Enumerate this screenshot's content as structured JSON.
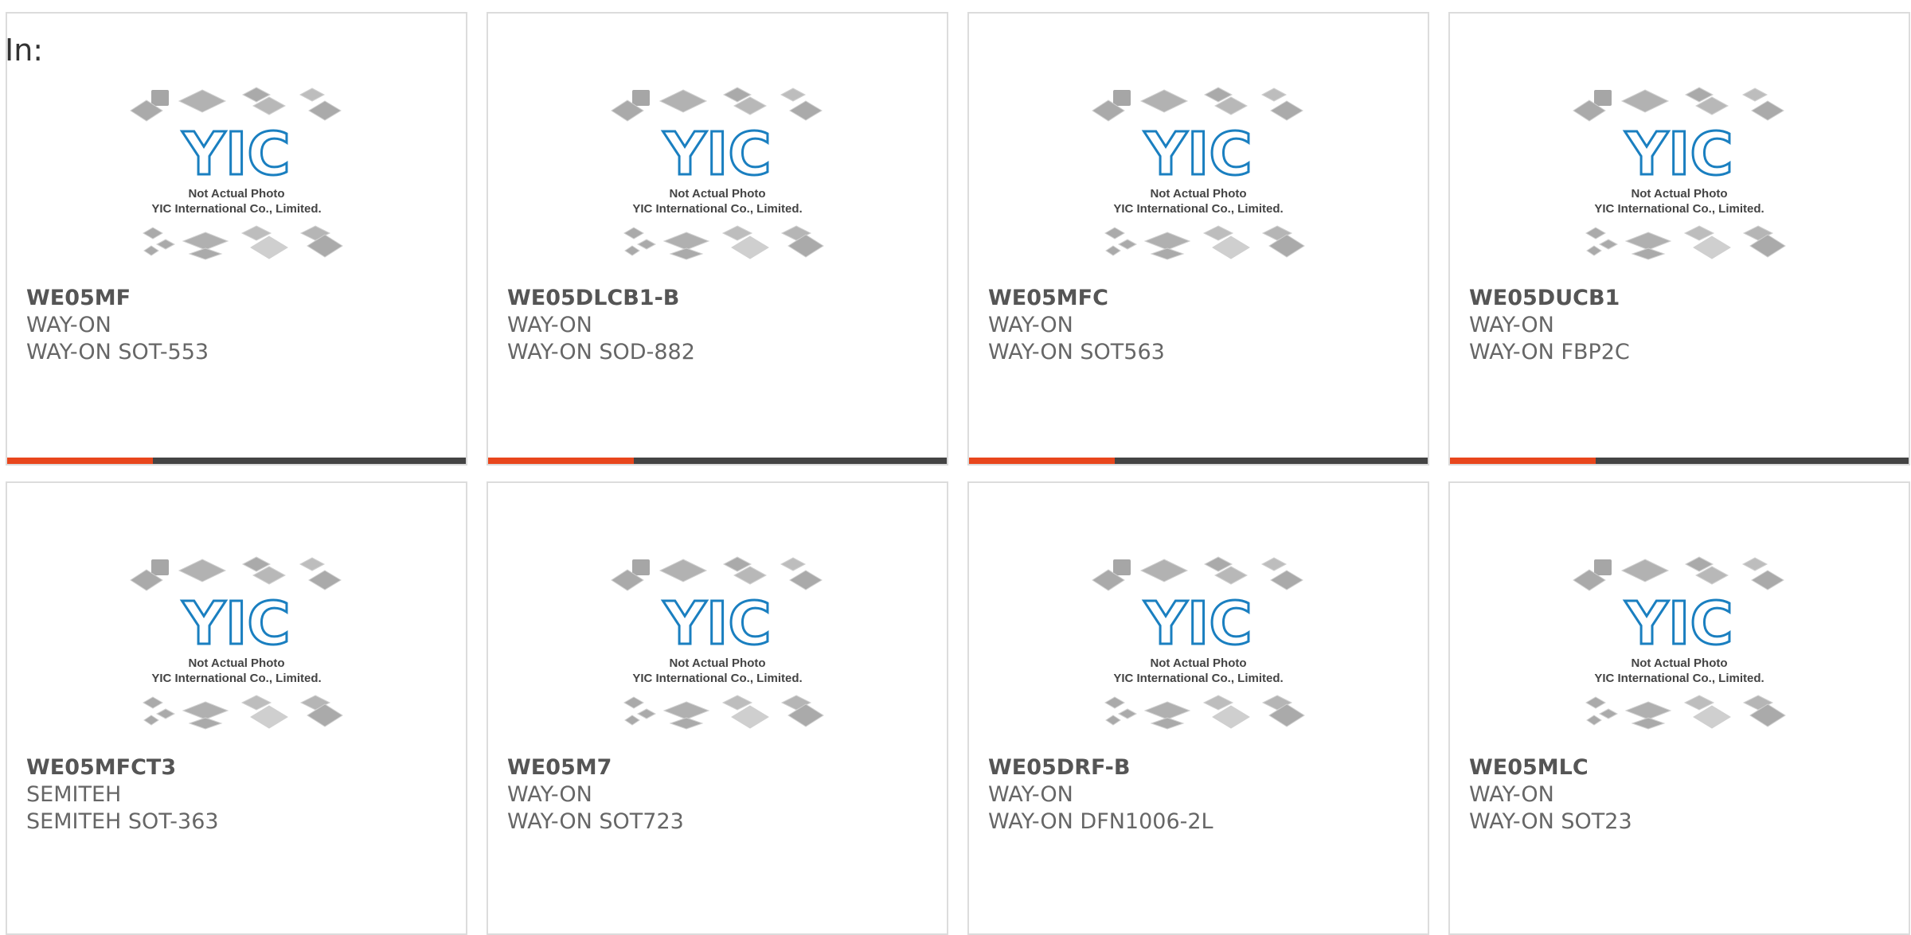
{
  "filter_label": "In:",
  "placeholder": {
    "caption_line1": "Not Actual Photo",
    "caption_line2": "YIC International Co., Limited.",
    "logo_text": "YIC"
  },
  "colors": {
    "accent": "#e8461c",
    "bar": "#444444",
    "logo": "#1a7fc0",
    "text": "#666666"
  },
  "products": [
    {
      "part": "WE05MF",
      "maker": "WAY-ON",
      "package": "WAY-ON SOT-553",
      "has_bar": true
    },
    {
      "part": "WE05DLCB1-B",
      "maker": "WAY-ON",
      "package": "WAY-ON SOD-882",
      "has_bar": true
    },
    {
      "part": "WE05MFC",
      "maker": "WAY-ON",
      "package": "WAY-ON SOT563",
      "has_bar": true
    },
    {
      "part": "WE05DUCB1",
      "maker": "WAY-ON",
      "package": "WAY-ON FBP2C",
      "has_bar": true
    },
    {
      "part": "WE05MFCT3",
      "maker": "SEMITEH",
      "package": "SEMITEH SOT-363",
      "has_bar": false
    },
    {
      "part": "WE05M7",
      "maker": "WAY-ON",
      "package": "WAY-ON SOT723",
      "has_bar": false
    },
    {
      "part": "WE05DRF-B",
      "maker": "WAY-ON",
      "package": "WAY-ON DFN1006-2L",
      "has_bar": false
    },
    {
      "part": "WE05MLC",
      "maker": "WAY-ON",
      "package": "WAY-ON SOT23",
      "has_bar": false
    }
  ]
}
